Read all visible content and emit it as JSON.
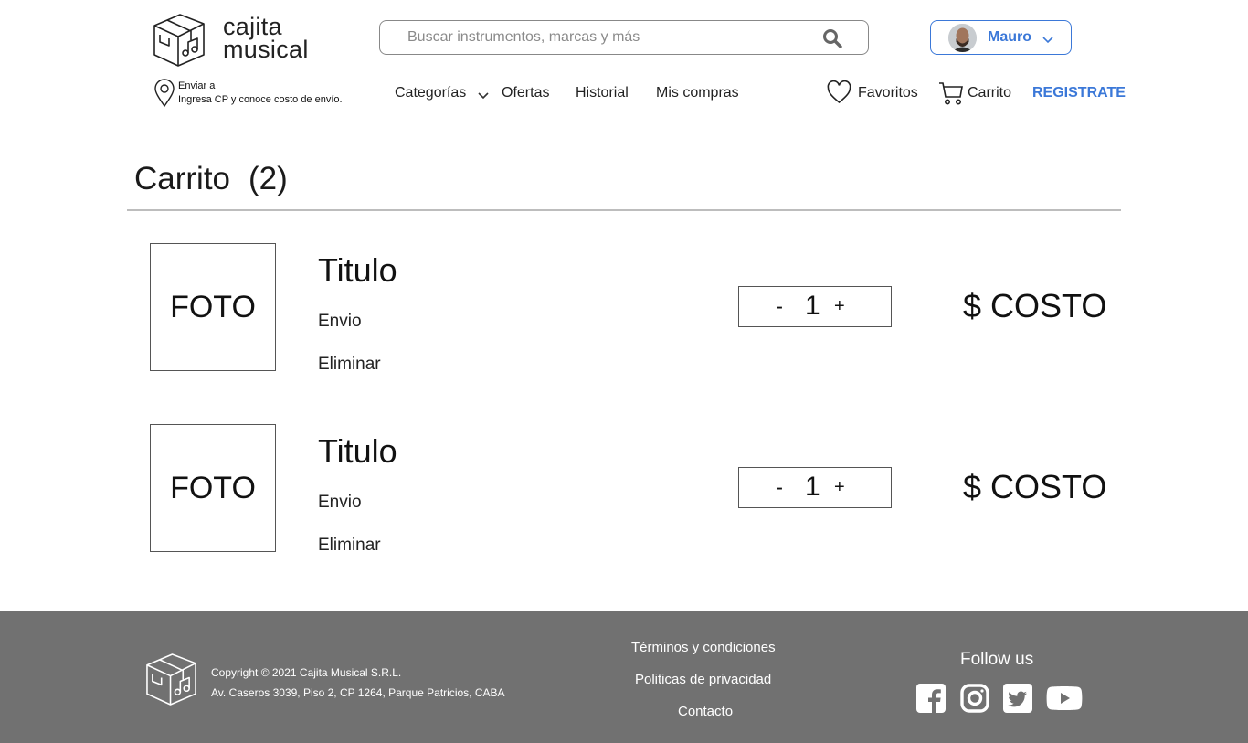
{
  "brand": {
    "line1": "cajita",
    "line2": "musical"
  },
  "search": {
    "placeholder": "Buscar instrumentos, marcas y más",
    "icon": "search-icon"
  },
  "user": {
    "name": "Mauro"
  },
  "shipping": {
    "line1": "Enviar a",
    "line2": "Ingresa CP y conoce costo de envío."
  },
  "nav": {
    "categories": "Categorías",
    "offers": "Ofertas",
    "history": "Historial",
    "purchases": "Mis compras"
  },
  "actions": {
    "favorites": "Favoritos",
    "cart": "Carrito",
    "register": "REGISTRATE"
  },
  "cart": {
    "title": "Carrito",
    "count": "(2)",
    "items": [
      {
        "photo": "FOTO",
        "title": "Titulo",
        "shipping": "Envio",
        "remove": "Eliminar",
        "minus": "-",
        "qty": "1",
        "plus": "+",
        "price": "$ COSTO"
      },
      {
        "photo": "FOTO",
        "title": "Titulo",
        "shipping": "Envio",
        "remove": "Eliminar",
        "minus": "-",
        "qty": "1",
        "plus": "+",
        "price": "$ COSTO"
      }
    ]
  },
  "footer": {
    "copyright": "Copyright © 2021 Cajita Musical S.R.L.",
    "address": "Av. Caseros 3039, Piso 2, CP 1264, Parque Patricios, CABA",
    "links": {
      "terms": "Términos y condiciones",
      "privacy": "Politicas de privacidad",
      "contact": "Contacto"
    },
    "follow": "Follow us",
    "social_icons": [
      "facebook-icon",
      "instagram-icon",
      "twitter-icon",
      "youtube-icon"
    ]
  },
  "colors": {
    "accent": "#3b78d8",
    "footer_bg": "#717171"
  }
}
